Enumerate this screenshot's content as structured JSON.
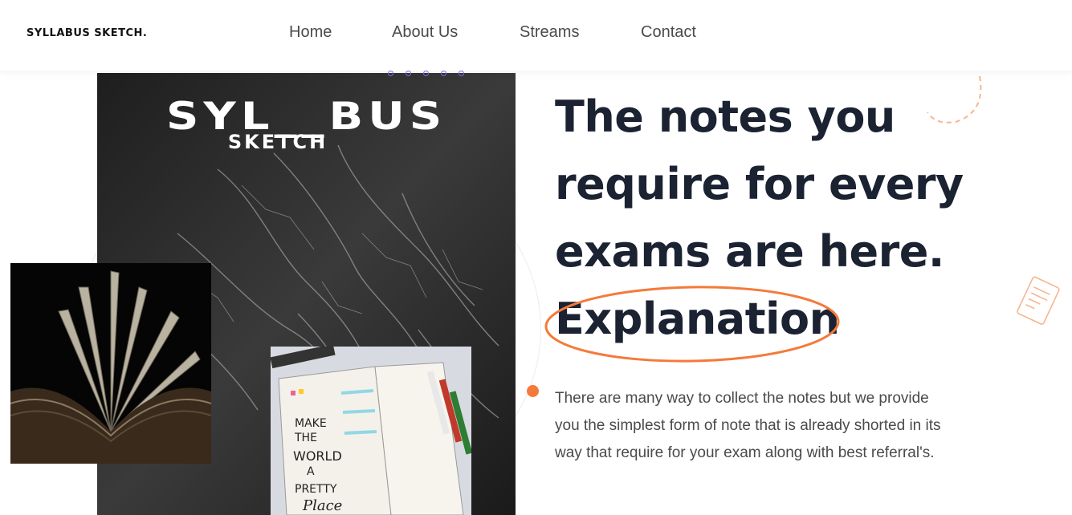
{
  "header": {
    "brand": "SYLLABUS SKETCH.",
    "nav": [
      {
        "label": "Home"
      },
      {
        "label": "About Us"
      },
      {
        "label": "Streams"
      },
      {
        "label": "Contact"
      }
    ]
  },
  "hero": {
    "logo_title": "SYL__BUS",
    "logo_subtitle": "SKETCH",
    "headline_lines": [
      "The notes you",
      "require for every",
      "exams are here.",
      "Explanation"
    ],
    "description_lines": [
      "There are many way to collect the notes but we provide",
      "you the simplest form of note that is already shorted in its",
      "way that require for your exam along with best referral's."
    ],
    "journal_text": [
      "MAKE",
      "THE",
      "WORLD",
      "A",
      "PRETTY",
      "Place"
    ]
  },
  "colors": {
    "accent": "#f47a3a",
    "heading": "#1b2232",
    "dots": "#7c6ee0"
  }
}
